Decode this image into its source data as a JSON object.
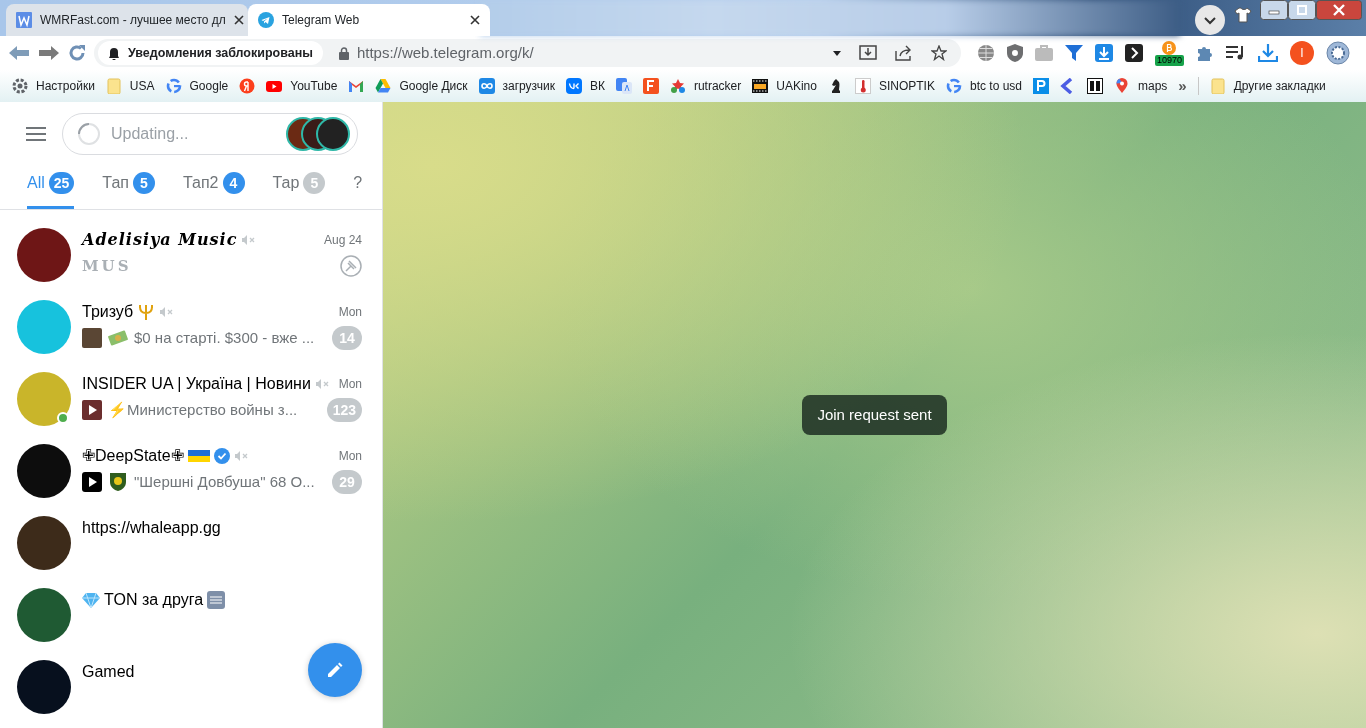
{
  "browser": {
    "tabs": [
      {
        "title": "WMRFast.com - лучшее место дл",
        "selected": false
      },
      {
        "title": "Telegram Web",
        "selected": true
      }
    ],
    "notification_chip": "Уведомления заблокированы",
    "url": "https://web.telegram.org/k/",
    "extension_badge": "10970",
    "profile_initial": "I",
    "bookmarks": [
      "Настройки",
      "USA",
      "Google",
      "YouTube",
      "Google Диск",
      "загрузчик",
      "ВК",
      "rutracker",
      "UAKino",
      "SINOPTIK",
      "btc to usd",
      "maps"
    ],
    "more_bookmarks": "»",
    "other_bookmarks": "Другие закладки"
  },
  "telegram": {
    "search": {
      "placeholder": "Updating..."
    },
    "folders": [
      {
        "label": "All",
        "count": "25",
        "selected": true,
        "muted": false
      },
      {
        "label": "Тап",
        "count": "5",
        "selected": false,
        "muted": false
      },
      {
        "label": "Тап2",
        "count": "4",
        "selected": false,
        "muted": false
      },
      {
        "label": "Тар",
        "count": "5",
        "selected": false,
        "muted": true
      },
      {
        "label": "?",
        "selected": false
      }
    ],
    "chats": [
      {
        "name": "Adelisiya Music",
        "decorative": true,
        "verified": false,
        "muted": true,
        "time": "Aug 24",
        "preview": "MUS",
        "pinned": true,
        "online": false,
        "color": "#6e1616"
      },
      {
        "name": "Тризуб",
        "decorative": false,
        "verified": false,
        "muted": true,
        "time": "Mon",
        "preview": "$0 на старті. $300 - вже ...",
        "unread": "14",
        "pinned": false,
        "online": false,
        "color": "#17c2dd"
      },
      {
        "name": "INSIDER UA | Україна | Новини",
        "decorative": false,
        "verified": false,
        "muted": true,
        "time": "Mon",
        "preview": "⚡Министерство войны з...",
        "unread": "123",
        "pinned": false,
        "online": true,
        "color": "#c9b52a"
      },
      {
        "name": "✙DeepState✙",
        "decorative": false,
        "verified": true,
        "muted": true,
        "time": "Mon",
        "preview": "\"Шершні Довбуша\" 68 О...",
        "unread": "29",
        "pinned": false,
        "online": false,
        "color": "#0d0d0d"
      },
      {
        "name": "https://whaleapp.gg",
        "decorative": false,
        "verified": false,
        "muted": false,
        "pinned": false,
        "online": false,
        "color": "#3d2b1a"
      },
      {
        "name": "TON за друга",
        "decorative": false,
        "verified": false,
        "muted": false,
        "pinned": false,
        "online": false,
        "color": "#1f5a33"
      },
      {
        "name": "Gamed",
        "decorative": false,
        "verified": false,
        "muted": false,
        "pinned": false,
        "online": false,
        "color": "#07101e"
      }
    ],
    "toast": "Join request sent"
  }
}
